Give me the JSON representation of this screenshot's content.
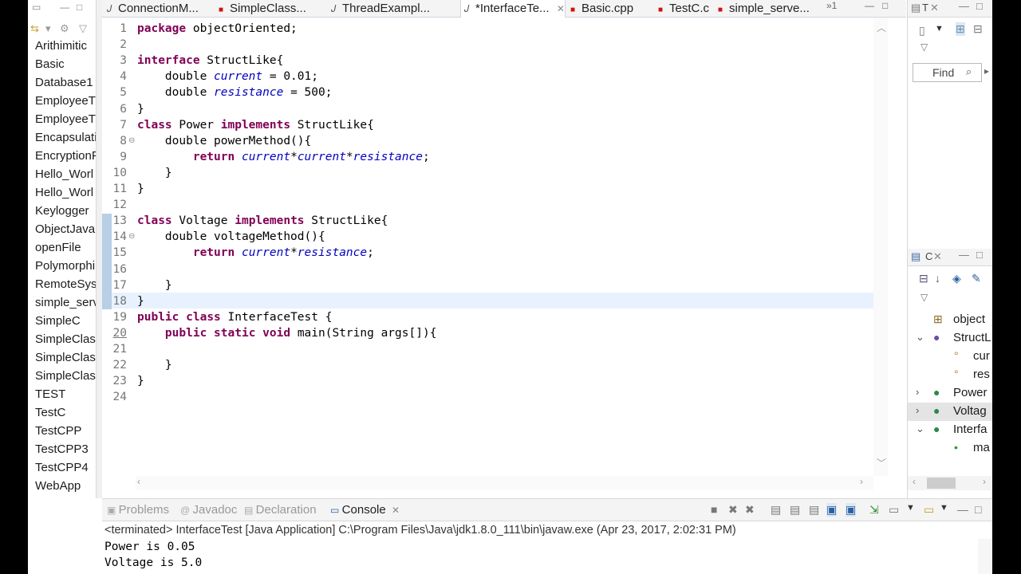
{
  "package_explorer": {
    "items": [
      "Arithimitic",
      "Basic",
      "Database1",
      "EmployeeT",
      "EmployeeT",
      "Encapsulati",
      "EncryptionF",
      "Hello_Worl",
      "Hello_Worl",
      "Keylogger",
      "ObjectJava",
      "openFile",
      "Polymorphi",
      "RemoteSyst",
      "simple_serv",
      "SimpleC",
      "SimpleClas",
      "SimpleClas",
      "SimpleClas",
      "TEST",
      "TestC",
      "TestCPP",
      "TestCPP3",
      "TestCPP4",
      "WebApp"
    ]
  },
  "editor_tabs": [
    {
      "label": "ConnectionM...",
      "icon": "java-file-icon",
      "error": false,
      "active": false
    },
    {
      "label": "SimpleClass...",
      "icon": "c-file-icon",
      "error": true,
      "active": false
    },
    {
      "label": "ThreadExampl...",
      "icon": "java-file-icon",
      "error": false,
      "active": false
    },
    {
      "label": "*InterfaceTe...",
      "icon": "java-file-icon",
      "error": false,
      "active": true
    },
    {
      "label": "Basic.cpp",
      "icon": "cpp-file-icon",
      "error": true,
      "active": false
    },
    {
      "label": "TestC.c",
      "icon": "c-file-icon",
      "error": true,
      "active": false
    },
    {
      "label": "simple_serve...",
      "icon": "c-file-icon",
      "error": true,
      "active": false
    }
  ],
  "editor_tab_overflow": "»1",
  "code_lines": [
    {
      "n": "1",
      "tokens": [
        {
          "t": "package",
          "c": "kw"
        },
        {
          "t": " objectOriented;",
          "c": ""
        }
      ]
    },
    {
      "n": "2",
      "tokens": []
    },
    {
      "n": "3",
      "tokens": [
        {
          "t": "interface",
          "c": "kw"
        },
        {
          "t": " StructLike{",
          "c": ""
        }
      ]
    },
    {
      "n": "4",
      "tokens": [
        {
          "t": "    double ",
          "c": ""
        },
        {
          "t": "current",
          "c": "fld"
        },
        {
          "t": " = 0.01;",
          "c": ""
        }
      ]
    },
    {
      "n": "5",
      "tokens": [
        {
          "t": "    double ",
          "c": ""
        },
        {
          "t": "resistance",
          "c": "fld"
        },
        {
          "t": " = 500;",
          "c": ""
        }
      ]
    },
    {
      "n": "6",
      "tokens": [
        {
          "t": "}",
          "c": ""
        }
      ]
    },
    {
      "n": "7",
      "tokens": [
        {
          "t": "class",
          "c": "kw"
        },
        {
          "t": " Power ",
          "c": ""
        },
        {
          "t": "implements",
          "c": "kw"
        },
        {
          "t": " StructLike{",
          "c": ""
        }
      ]
    },
    {
      "n": "8",
      "tokens": [
        {
          "t": "    double powerMethod(){",
          "c": ""
        }
      ]
    },
    {
      "n": "9",
      "tokens": [
        {
          "t": "        ",
          "c": ""
        },
        {
          "t": "return",
          "c": "kw"
        },
        {
          "t": " ",
          "c": ""
        },
        {
          "t": "current",
          "c": "fld"
        },
        {
          "t": "*",
          "c": ""
        },
        {
          "t": "current",
          "c": "fld"
        },
        {
          "t": "*",
          "c": ""
        },
        {
          "t": "resistance",
          "c": "fld"
        },
        {
          "t": ";",
          "c": ""
        }
      ]
    },
    {
      "n": "10",
      "tokens": [
        {
          "t": "    }",
          "c": ""
        }
      ]
    },
    {
      "n": "11",
      "tokens": [
        {
          "t": "}",
          "c": ""
        }
      ]
    },
    {
      "n": "12",
      "tokens": []
    },
    {
      "n": "13",
      "tokens": [
        {
          "t": "class",
          "c": "kw"
        },
        {
          "t": " Voltage ",
          "c": ""
        },
        {
          "t": "implements",
          "c": "kw"
        },
        {
          "t": " StructLike{",
          "c": ""
        }
      ]
    },
    {
      "n": "14",
      "tokens": [
        {
          "t": "    double voltageMethod(){",
          "c": ""
        }
      ]
    },
    {
      "n": "15",
      "tokens": [
        {
          "t": "        ",
          "c": ""
        },
        {
          "t": "return",
          "c": "kw"
        },
        {
          "t": " ",
          "c": ""
        },
        {
          "t": "current",
          "c": "fld"
        },
        {
          "t": "*",
          "c": ""
        },
        {
          "t": "resistance",
          "c": "fld"
        },
        {
          "t": ";",
          "c": ""
        }
      ]
    },
    {
      "n": "16",
      "tokens": []
    },
    {
      "n": "17",
      "tokens": [
        {
          "t": "    }",
          "c": ""
        }
      ]
    },
    {
      "n": "18",
      "tokens": [
        {
          "t": "}",
          "c": ""
        }
      ]
    },
    {
      "n": "19",
      "tokens": [
        {
          "t": "public",
          "c": "kw"
        },
        {
          "t": " ",
          "c": ""
        },
        {
          "t": "class",
          "c": "kw"
        },
        {
          "t": " InterfaceTest {",
          "c": ""
        }
      ]
    },
    {
      "n": "20",
      "tokens": [
        {
          "t": "    ",
          "c": ""
        },
        {
          "t": "public",
          "c": "kw"
        },
        {
          "t": " ",
          "c": ""
        },
        {
          "t": "static",
          "c": "kw"
        },
        {
          "t": " ",
          "c": ""
        },
        {
          "t": "void",
          "c": "kw"
        },
        {
          "t": " main(String args[]){",
          "c": ""
        }
      ]
    },
    {
      "n": "21",
      "tokens": []
    },
    {
      "n": "22",
      "tokens": [
        {
          "t": "    }",
          "c": ""
        }
      ]
    },
    {
      "n": "23",
      "tokens": [
        {
          "t": "}",
          "c": ""
        }
      ]
    },
    {
      "n": "24",
      "tokens": []
    }
  ],
  "task_panel": {
    "title": "T",
    "find_label": "Find"
  },
  "outline_panel": {
    "title": "C",
    "items": [
      {
        "label": "object",
        "icon": "package-icon",
        "expander": ""
      },
      {
        "label": "StructL",
        "icon": "interface-icon",
        "expander": "v"
      },
      {
        "label": "cur",
        "icon": "field-icon",
        "expander": ""
      },
      {
        "label": "res",
        "icon": "field-icon",
        "expander": ""
      },
      {
        "label": "Power",
        "icon": "class-icon",
        "expander": ">"
      },
      {
        "label": "Voltag",
        "icon": "class-icon",
        "expander": ">"
      },
      {
        "label": "Interfa",
        "icon": "class-icon",
        "expander": "v"
      },
      {
        "label": "ma",
        "icon": "method-icon",
        "expander": ""
      }
    ]
  },
  "console_tabs": [
    {
      "label": "Problems",
      "icon": "problems-icon",
      "active": false
    },
    {
      "label": "Javadoc",
      "icon": "javadoc-icon",
      "active": false
    },
    {
      "label": "Declaration",
      "icon": "declaration-icon",
      "active": false
    },
    {
      "label": "Console",
      "icon": "console-icon",
      "active": true
    }
  ],
  "console": {
    "terminated_line": "<terminated> InterfaceTest [Java Application] C:\\Program Files\\Java\\jdk1.8.0_111\\bin\\javaw.exe (Apr 23, 2017, 2:02:31 PM)",
    "output": [
      "Power is 0.05",
      "Voltage is 5.0"
    ]
  },
  "colors": {
    "keyword": "#7f0055",
    "field": "#0000c0",
    "active_line": "#e8f2fe",
    "error_marker": "#d01010"
  }
}
